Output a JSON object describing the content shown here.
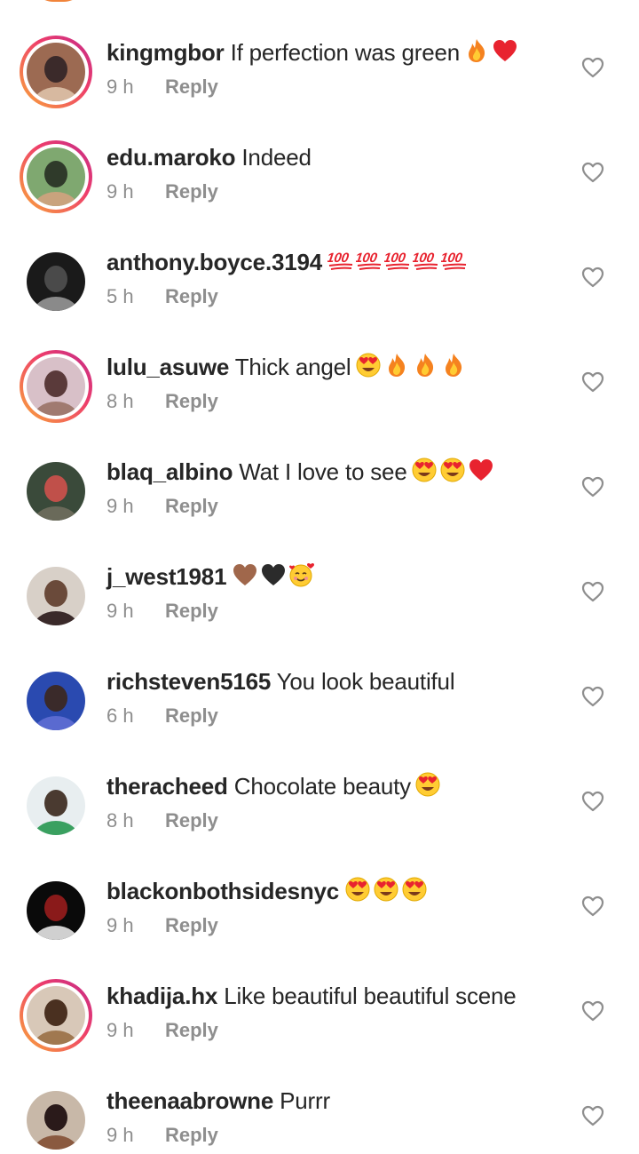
{
  "comments": [
    {
      "username": "kingmgbor",
      "text": "If perfection was green",
      "emojis": [
        "fire-emoji",
        "red-heart-emoji"
      ],
      "time": "9 h",
      "reply_label": "Reply",
      "has_story_ring": true,
      "avatar_colors": [
        "#9c6a52",
        "#3b2a2a",
        "#d7b9a0"
      ]
    },
    {
      "username": "edu.maroko",
      "text": "Indeed",
      "emojis": [],
      "time": "9 h",
      "reply_label": "Reply",
      "has_story_ring": true,
      "avatar_colors": [
        "#7fa870",
        "#2f3a2a",
        "#c9a37d"
      ]
    },
    {
      "username": "anthony.boyce.3194",
      "text": "",
      "emojis": [
        "hundred-points-emoji",
        "hundred-points-emoji",
        "hundred-points-emoji",
        "hundred-points-emoji",
        "hundred-points-emoji"
      ],
      "time": "5 h",
      "reply_label": "Reply",
      "has_story_ring": false,
      "avatar_colors": [
        "#1a1a1a",
        "#4a4a4a",
        "#8a8a8a"
      ]
    },
    {
      "username": "lulu_asuwe",
      "text": "Thick angel",
      "emojis": [
        "heart-eyes-emoji",
        "fire-emoji",
        "fire-emoji",
        "fire-emoji"
      ],
      "time": "8 h",
      "reply_label": "Reply",
      "has_story_ring": true,
      "avatar_colors": [
        "#d8c0c8",
        "#5a3a3a",
        "#a07a70"
      ]
    },
    {
      "username": "blaq_albino",
      "text": "Wat I love to see",
      "emojis": [
        "heart-eyes-emoji",
        "heart-eyes-emoji",
        "red-heart-emoji"
      ],
      "time": "9 h",
      "reply_label": "Reply",
      "has_story_ring": false,
      "avatar_colors": [
        "#3a4a3a",
        "#c0504a",
        "#6a6a5a"
      ]
    },
    {
      "username": "j_west1981",
      "text": "",
      "emojis": [
        "brown-heart-emoji",
        "black-heart-emoji",
        "smiling-face-with-hearts-emoji"
      ],
      "time": "9 h",
      "reply_label": "Reply",
      "has_story_ring": false,
      "avatar_colors": [
        "#d8d0c8",
        "#6a4a3a",
        "#3a2a2a"
      ]
    },
    {
      "username": "richsteven5165",
      "text": "You look beautiful",
      "emojis": [],
      "time": "6 h",
      "reply_label": "Reply",
      "has_story_ring": false,
      "avatar_colors": [
        "#2a4ab0",
        "#3a2a2a",
        "#5a6ad0"
      ]
    },
    {
      "username": "theracheed",
      "text": "Chocolate beauty",
      "emojis": [
        "heart-eyes-emoji"
      ],
      "time": "8 h",
      "reply_label": "Reply",
      "has_story_ring": false,
      "avatar_colors": [
        "#e8eef0",
        "#4a3a30",
        "#3aa060"
      ]
    },
    {
      "username": "blackonbothsidesnyc",
      "text": "",
      "emojis": [
        "heart-eyes-emoji",
        "heart-eyes-emoji",
        "heart-eyes-emoji"
      ],
      "time": "9 h",
      "reply_label": "Reply",
      "has_story_ring": false,
      "avatar_colors": [
        "#0a0a0a",
        "#8a1a1a",
        "#d0d0d0"
      ]
    },
    {
      "username": "khadija.hx",
      "text": "Like beautiful beautiful scene",
      "emojis": [],
      "time": "9 h",
      "reply_label": "Reply",
      "has_story_ring": true,
      "avatar_colors": [
        "#d8c8b8",
        "#4a3020",
        "#a07850"
      ]
    },
    {
      "username": "theenaabrowne",
      "text": "Purrr",
      "emojis": [],
      "time": "9 h",
      "reply_label": "Reply",
      "has_story_ring": false,
      "avatar_colors": [
        "#c8b8a8",
        "#2a1a1a",
        "#8a5a40"
      ]
    }
  ],
  "colors": {
    "username": "#262626",
    "meta": "#8e8e8e",
    "heart_outline": "#8e8e8e",
    "story_ring_start": "#f9a83a",
    "story_ring_end": "#c22b8a"
  }
}
